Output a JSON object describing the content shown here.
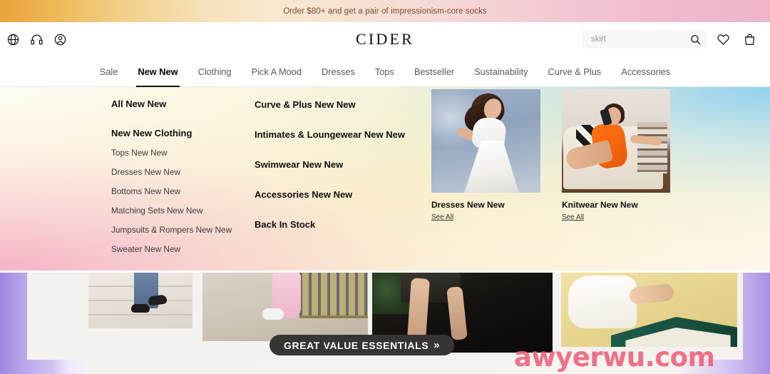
{
  "promo": {
    "text": "Order $80+ and get a pair of impressionism-core socks"
  },
  "header": {
    "logo": "CIDER",
    "icons": [
      {
        "name": "globe-icon",
        "label": "Language / Region"
      },
      {
        "name": "headset-icon",
        "label": "Customer Service"
      },
      {
        "name": "account-icon",
        "label": "Account"
      }
    ],
    "search": {
      "placeholder": "skirt",
      "value": "",
      "button_label": "Search"
    },
    "actions": [
      {
        "name": "wishlist-icon",
        "label": "Wishlist"
      },
      {
        "name": "bag-icon",
        "label": "Bag"
      }
    ]
  },
  "nav": {
    "items": [
      {
        "label": "Sale",
        "active": false
      },
      {
        "label": "New New",
        "active": true
      },
      {
        "label": "Clothing",
        "active": false
      },
      {
        "label": "Pick A Mood",
        "active": false
      },
      {
        "label": "Dresses",
        "active": false
      },
      {
        "label": "Tops",
        "active": false
      },
      {
        "label": "Bestseller",
        "active": false
      },
      {
        "label": "Sustainability",
        "active": false
      },
      {
        "label": "Curve & Plus",
        "active": false
      },
      {
        "label": "Accessories",
        "active": false
      }
    ]
  },
  "mega_menu": {
    "column_left": {
      "all_link": "All New New",
      "group_title": "New New Clothing",
      "items": [
        "Tops New New",
        "Dresses New New",
        "Bottoms New New",
        "Matching Sets New New",
        "Jumpsuits & Rompers New New",
        "Sweater New New"
      ]
    },
    "column_middle": {
      "items": [
        "Curve & Plus New New",
        "Intimates & Loungewear New New",
        "Swimwear New New",
        "Accessories New New",
        "Back In Stock"
      ]
    },
    "cards": [
      {
        "caption": "Dresses New New",
        "see_all": "See All",
        "image": "model-white-dress-blue-sky"
      },
      {
        "caption": "Knitwear New New",
        "see_all": "See All",
        "image": "model-orange-dress-sofa"
      }
    ]
  },
  "hero": {
    "badge_text": "GREAT VALUE ESSENTIALS",
    "badge_chevron": "»",
    "watermark": "awyerwu.com",
    "tiles": [
      {
        "image": "feet-on-steps-black-flats"
      },
      {
        "image": "pink-pants-sneakers-fence"
      },
      {
        "image": "legs-black-skirt-night"
      },
      {
        "image": "white-sleeve-green-tile"
      }
    ]
  },
  "colors": {
    "promo_text": "#7d4a2e",
    "nav_active": "#000000",
    "badge_bg": "#373432",
    "watermark": "#f0657f"
  }
}
